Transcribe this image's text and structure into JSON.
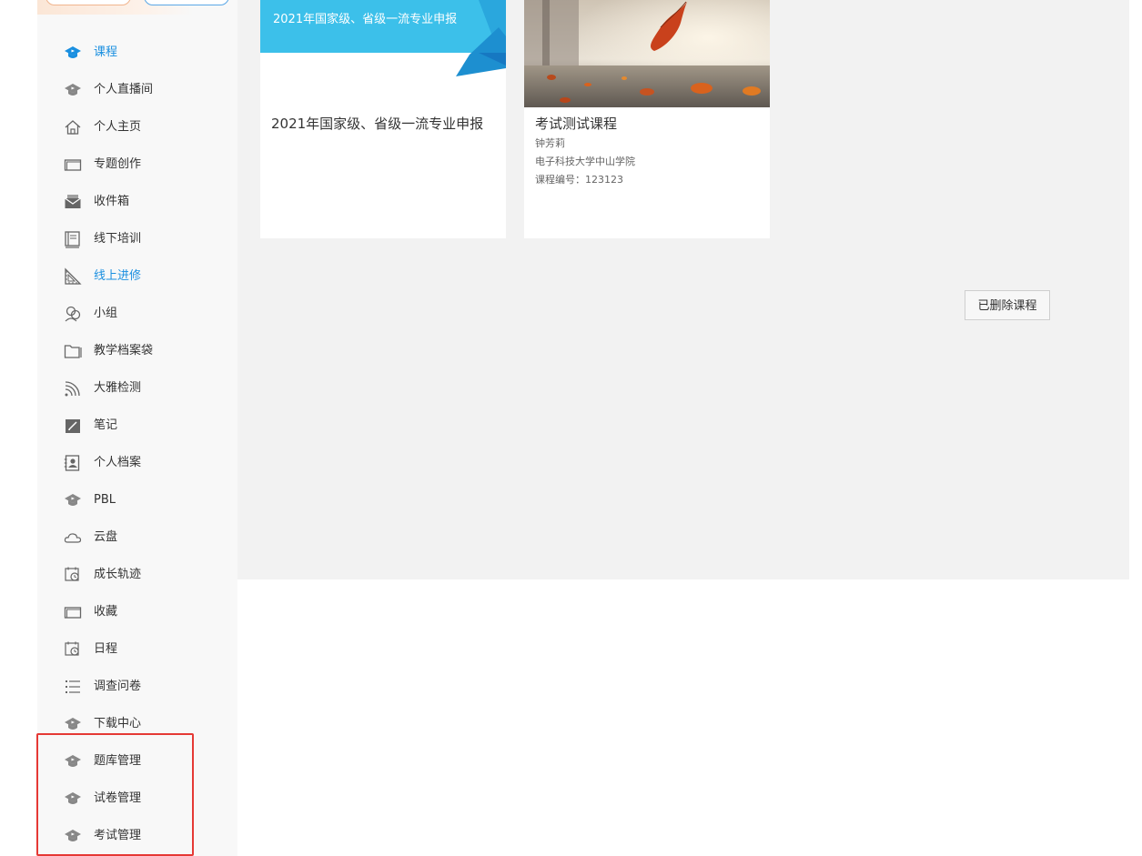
{
  "sidebar": {
    "items": [
      {
        "label": "课程",
        "icon": "graduation-cap-icon",
        "active": true
      },
      {
        "label": "个人直播间",
        "icon": "graduation-cap-icon"
      },
      {
        "label": "个人主页",
        "icon": "home-icon"
      },
      {
        "label": "专题创作",
        "icon": "window-icon"
      },
      {
        "label": "收件箱",
        "icon": "envelope-icon"
      },
      {
        "label": "线下培训",
        "icon": "book-icon"
      },
      {
        "label": "线上进修",
        "icon": "ruler-icon",
        "active": true
      },
      {
        "label": "小组",
        "icon": "group-icon"
      },
      {
        "label": "教学档案袋",
        "icon": "folder-icon"
      },
      {
        "label": "大雅检测",
        "icon": "signal-icon"
      },
      {
        "label": "笔记",
        "icon": "note-icon"
      },
      {
        "label": "个人档案",
        "icon": "profile-icon"
      },
      {
        "label": "PBL",
        "icon": "graduation-cap-icon"
      },
      {
        "label": "云盘",
        "icon": "cloud-icon"
      },
      {
        "label": "成长轨迹",
        "icon": "calendar-clock-icon"
      },
      {
        "label": "收藏",
        "icon": "window-icon"
      },
      {
        "label": "日程",
        "icon": "calendar-clock-icon"
      },
      {
        "label": "调查问卷",
        "icon": "list-icon"
      },
      {
        "label": "下载中心",
        "icon": "graduation-cap-icon"
      },
      {
        "label": "题库管理",
        "icon": "graduation-cap-icon"
      },
      {
        "label": "试卷管理",
        "icon": "graduation-cap-icon"
      },
      {
        "label": "考试管理",
        "icon": "graduation-cap-icon"
      }
    ]
  },
  "courses": [
    {
      "banner_text": "2021年国家级、省级一流专业申报",
      "title": "2021年国家级、省级一流专业申报"
    },
    {
      "title": "考试测试课程",
      "teacher": "钟芳莉",
      "school": "电子科技大学中山学院",
      "code": "课程编号：123123"
    }
  ],
  "deleted_courses_button": "已删除课程",
  "colors": {
    "accent": "#1a8fe0",
    "banner": "#3cc0ea",
    "highlight": "#e53935"
  }
}
